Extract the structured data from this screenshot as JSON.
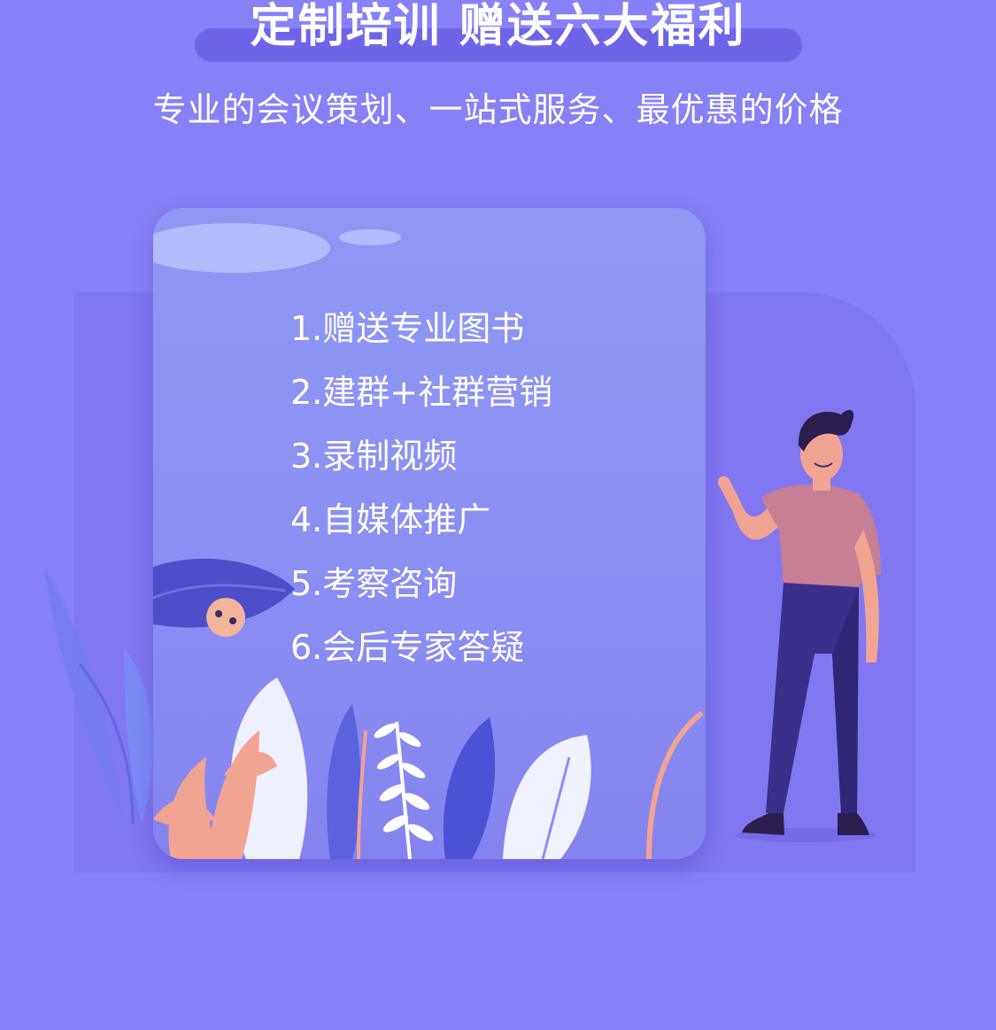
{
  "header": {
    "title": "定制培训 赠送六大福利",
    "subtitle": "专业的会议策划、一站式服务、最优惠的价格"
  },
  "benefits": [
    "1.赠送专业图书",
    "2.建群+社群营销",
    "3.录制视频",
    "4.自媒体推广",
    "5.考察咨询",
    "6.会后专家答疑"
  ],
  "colors": {
    "background": "#8880f6",
    "title_bar": "#6f64e8",
    "card": "#8e98f3",
    "text": "#ffffff"
  }
}
